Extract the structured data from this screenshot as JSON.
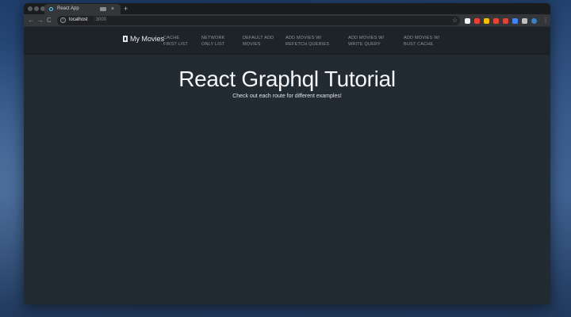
{
  "browser": {
    "tab_title": "React App",
    "tab_close": "×",
    "new_tab": "+",
    "url_host": "localhost",
    "url_port": ":3000",
    "info_glyph": "i",
    "back_glyph": "←",
    "forward_glyph": "→",
    "reload_glyph": "C",
    "star_glyph": "☆",
    "menu_glyph": "⋮",
    "extension_colors": [
      "#f1f3f4",
      "#e94235",
      "#fbbc04",
      "#ea4335",
      "#db4437",
      "#4285f4",
      "#c0c0c0",
      "#3b82c4"
    ]
  },
  "app": {
    "brand": "My Movies",
    "nav_links": [
      {
        "line1": "CACHE",
        "line2": "FIRST LIST"
      },
      {
        "line1": "NETWORK",
        "line2": "ONLY LIST"
      },
      {
        "line1": "DEFAULT ADD",
        "line2": "MOVIES"
      },
      {
        "line1": "ADD MOVIES W/",
        "line2": "REFETCH QUERIES"
      },
      {
        "line1": "ADD MOVIES W/",
        "line2": "WRITE QUERY"
      },
      {
        "line1": "ADD MOVIES W/",
        "line2": "BUST CACHE"
      }
    ],
    "title": "React Graphql Tutorial",
    "subtitle": "Check out each route for different examples!"
  },
  "colors": {
    "background": "#232b32",
    "navbar": "#1e2327",
    "nav_link": "#8f989f",
    "title": "#f3f5f6"
  }
}
